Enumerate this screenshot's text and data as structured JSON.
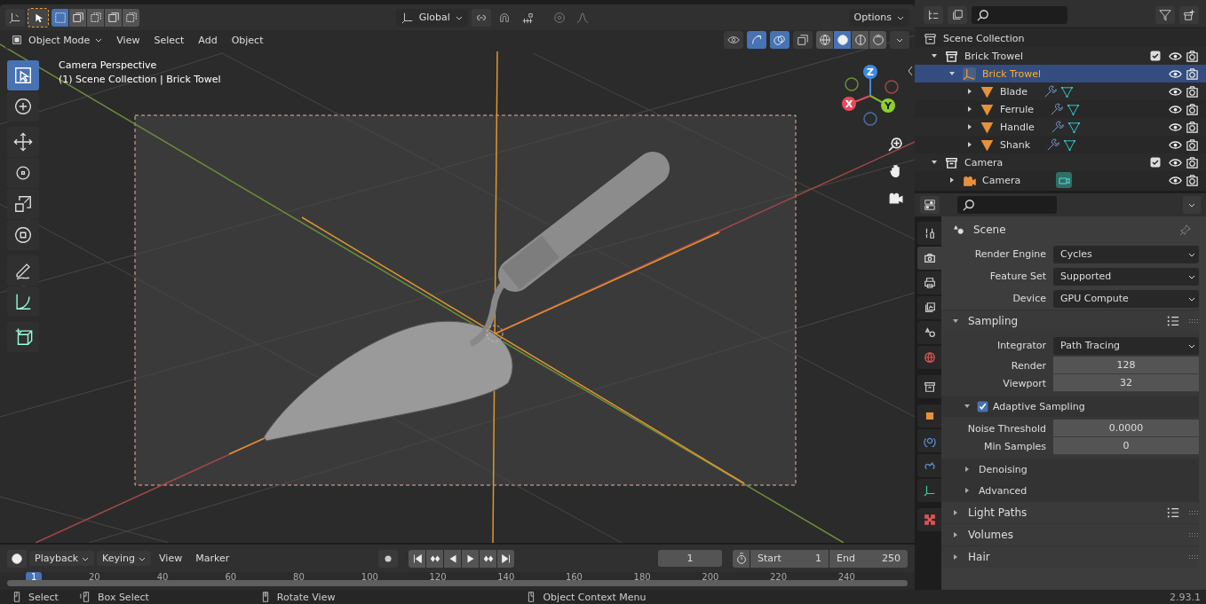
{
  "top_bar": {
    "select_modes": [
      {
        "selected": true
      },
      {
        "selected": false
      },
      {
        "selected": false
      },
      {
        "selected": false
      },
      {
        "selected": false
      }
    ],
    "orientation": "Global",
    "options": "Options"
  },
  "viewport_header": {
    "mode": "Object Mode",
    "menus": [
      "View",
      "Select",
      "Add",
      "Object"
    ],
    "gizmos_on": true,
    "overlays_on": true,
    "shading": [
      {
        "kind": "wireframe",
        "selected": false
      },
      {
        "kind": "solid",
        "selected": true
      },
      {
        "kind": "material",
        "selected": false
      },
      {
        "kind": "rendered",
        "selected": false
      }
    ]
  },
  "viewport": {
    "info": [
      "Camera Perspective",
      "(1) Scene Collection | Brick Towel"
    ],
    "tools": [
      {
        "kind": "select",
        "selected": true
      },
      {
        "kind": "cursor",
        "selected": false
      },
      {
        "kind": "move",
        "selected": false
      },
      {
        "kind": "rotate",
        "selected": false
      },
      {
        "kind": "scale",
        "selected": false
      },
      {
        "kind": "transform",
        "selected": false
      },
      {
        "kind": "annotate",
        "selected": false
      },
      {
        "kind": "measure",
        "selected": false
      },
      {
        "kind": "add_cube",
        "selected": false
      }
    ],
    "gizmo_axes": [
      "X",
      "Y",
      "Z"
    ]
  },
  "outliner": {
    "root": "Scene Collection",
    "items": [
      {
        "name": "Brick Trowel",
        "kind": "collection",
        "checked": true,
        "selected": false,
        "expanded": true,
        "children": [
          {
            "name": "Brick Trowel",
            "kind": "empty",
            "selected": true,
            "expanded": true,
            "children": [
              {
                "name": "Blade",
                "kind": "mesh",
                "selected": false,
                "expanded": false
              },
              {
                "name": "Ferrule",
                "kind": "mesh",
                "selected": false,
                "expanded": false
              },
              {
                "name": "Handle",
                "kind": "mesh",
                "selected": false,
                "expanded": false
              },
              {
                "name": "Shank",
                "kind": "mesh",
                "selected": false,
                "expanded": false
              }
            ]
          }
        ]
      },
      {
        "name": "Camera",
        "kind": "collection",
        "checked": true,
        "selected": false,
        "expanded": true,
        "children": [
          {
            "name": "Camera",
            "kind": "camera",
            "selected": false,
            "expanded": false
          }
        ]
      }
    ]
  },
  "properties": {
    "tabs": [
      {
        "kind": "tool",
        "selected": false
      },
      {
        "kind": "render",
        "selected": true
      },
      {
        "kind": "output",
        "selected": false
      },
      {
        "kind": "view_layer",
        "selected": false
      },
      {
        "kind": "scene",
        "selected": false
      },
      {
        "kind": "world",
        "selected": false
      },
      {
        "kind": "collection",
        "selected": false
      },
      {
        "kind": "object",
        "selected": false
      },
      {
        "kind": "physics",
        "selected": false
      },
      {
        "kind": "constraints",
        "selected": false
      },
      {
        "kind": "data",
        "selected": false
      },
      {
        "kind": "texture",
        "selected": false
      }
    ],
    "context": "Scene",
    "fields": [
      {
        "label": "Render Engine",
        "value": "Cycles",
        "kind": "dropdown"
      },
      {
        "label": "Feature Set",
        "value": "Supported",
        "kind": "dropdown"
      },
      {
        "label": "Device",
        "value": "GPU Compute",
        "kind": "dropdown"
      }
    ],
    "panels": [
      {
        "title": "Sampling",
        "expanded": true,
        "presets": true,
        "fields": [
          {
            "label": "Integrator",
            "value": "Path Tracing",
            "kind": "dropdown"
          },
          {
            "label": "Render",
            "value": "128",
            "kind": "number"
          },
          {
            "label": "Viewport",
            "value": "32",
            "kind": "number"
          }
        ],
        "subpanels": [
          {
            "title": "Adaptive Sampling",
            "expanded": true,
            "checkbox": true,
            "checked": true,
            "fields": [
              {
                "label": "Noise Threshold",
                "value": "0.0000",
                "kind": "number"
              },
              {
                "label": "Min Samples",
                "value": "0",
                "kind": "number"
              }
            ]
          },
          {
            "title": "Denoising",
            "expanded": false,
            "checkbox": false
          },
          {
            "title": "Advanced",
            "expanded": false,
            "checkbox": false
          }
        ]
      },
      {
        "title": "Light Paths",
        "expanded": false,
        "presets": true
      },
      {
        "title": "Volumes",
        "expanded": false,
        "presets": false
      },
      {
        "title": "Hair",
        "expanded": false,
        "presets": false
      }
    ]
  },
  "timeline": {
    "menus": [
      "Playback",
      "Keying",
      "View",
      "Marker"
    ],
    "frame": "1",
    "start_label": "Start",
    "start": "1",
    "end_label": "End",
    "end": "250",
    "ruler": [
      {
        "label": "1",
        "current": true
      },
      {
        "label": "20",
        "current": false
      },
      {
        "label": "40",
        "current": false
      },
      {
        "label": "60",
        "current": false
      },
      {
        "label": "80",
        "current": false
      },
      {
        "label": "100",
        "current": false
      },
      {
        "label": "120",
        "current": false
      },
      {
        "label": "140",
        "current": false
      },
      {
        "label": "160",
        "current": false
      },
      {
        "label": "180",
        "current": false
      },
      {
        "label": "200",
        "current": false
      },
      {
        "label": "220",
        "current": false
      },
      {
        "label": "240",
        "current": false
      }
    ]
  },
  "status_bar": {
    "hints": [
      {
        "kind": "left",
        "text": "Select"
      },
      {
        "kind": "drag",
        "text": "Box Select"
      },
      {
        "kind": "middle",
        "text": "Rotate View"
      },
      {
        "kind": "right",
        "text": "Object Context Menu"
      }
    ],
    "version": "2.93.1"
  }
}
